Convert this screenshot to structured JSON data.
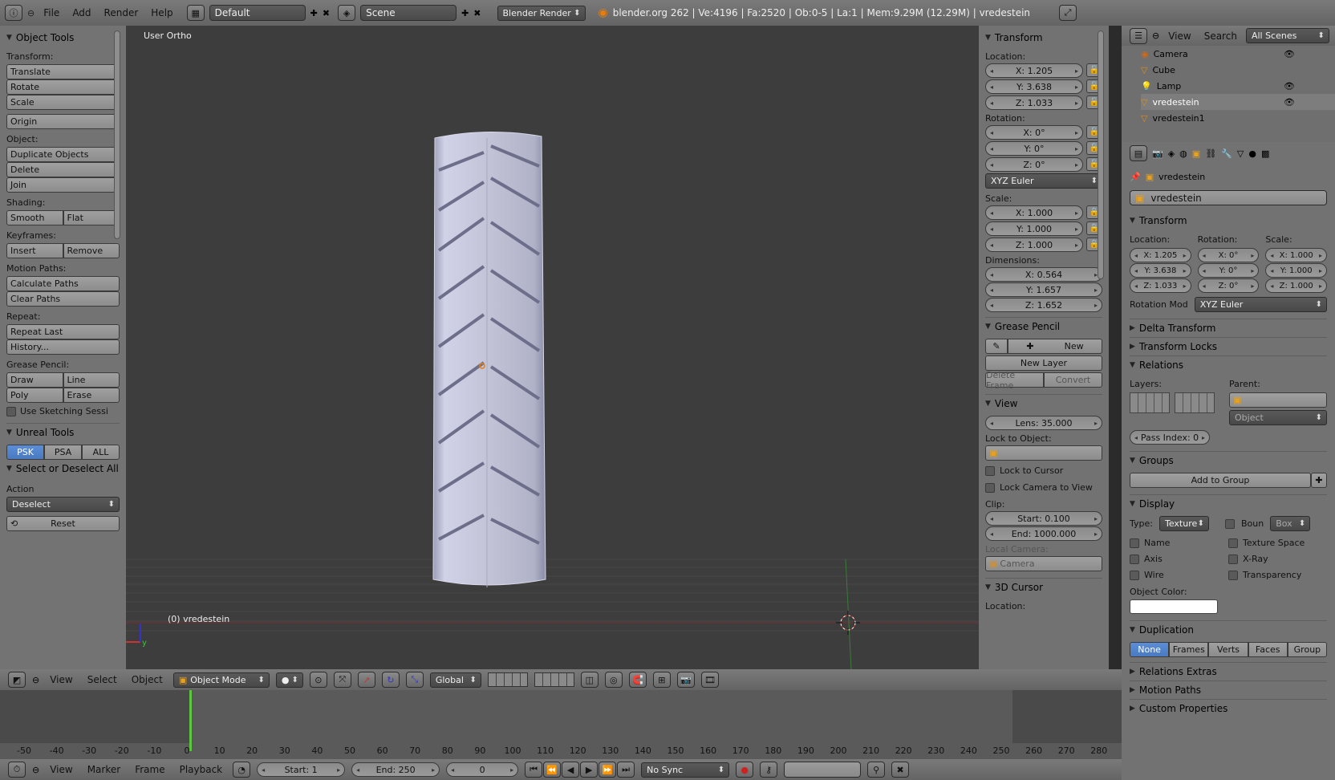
{
  "topbar": {
    "menus": [
      "File",
      "Add",
      "Render",
      "Help"
    ],
    "layout": "Default",
    "scene": "Scene",
    "engine": "Blender Render",
    "stats": "blender.org 262 | Ve:4196 | Fa:2520 | Ob:0-5 | La:1 | Mem:9.29M (12.29M) | vredestein"
  },
  "toolshelf": {
    "title": "Object Tools",
    "transform_label": "Transform:",
    "translate": "Translate",
    "rotate": "Rotate",
    "scale": "Scale",
    "origin": "Origin",
    "object_label": "Object:",
    "duplicate": "Duplicate Objects",
    "delete": "Delete",
    "join": "Join",
    "shading_label": "Shading:",
    "smooth": "Smooth",
    "flat": "Flat",
    "keyframes_label": "Keyframes:",
    "insert": "Insert",
    "remove": "Remove",
    "motion_label": "Motion Paths:",
    "calc_paths": "Calculate Paths",
    "clear_paths": "Clear Paths",
    "repeat_label": "Repeat:",
    "repeat_last": "Repeat Last",
    "history": "History...",
    "grease_label": "Grease Pencil:",
    "draw": "Draw",
    "line": "Line",
    "poly": "Poly",
    "erase": "Erase",
    "sketch": "Use Sketching Sessi",
    "unreal_title": "Unreal Tools",
    "psk": "PSK",
    "psa": "PSA",
    "all": "ALL",
    "select_title": "Select or Deselect All",
    "action_label": "Action",
    "action_value": "Deselect",
    "reset": "Reset"
  },
  "viewport": {
    "view_name": "User Ortho",
    "object_name": "(0) vredestein"
  },
  "npanel": {
    "transform_title": "Transform",
    "location_label": "Location:",
    "loc": [
      "X: 1.205",
      "Y: 3.638",
      "Z: 1.033"
    ],
    "rotation_label": "Rotation:",
    "rot": [
      "X: 0°",
      "Y: 0°",
      "Z: 0°"
    ],
    "rot_mode": "XYZ Euler",
    "scale_label": "Scale:",
    "scale": [
      "X: 1.000",
      "Y: 1.000",
      "Z: 1.000"
    ],
    "dim_label": "Dimensions:",
    "dim": [
      "X: 0.564",
      "Y: 1.657",
      "Z: 1.652"
    ],
    "grease_title": "Grease Pencil",
    "new": "New",
    "new_layer": "New Layer",
    "delete_frame": "Delete Frame",
    "convert": "Convert",
    "view_title": "View",
    "lens": "Lens: 35.000",
    "lock_obj_label": "Lock to Object:",
    "lock_cursor": "Lock to Cursor",
    "lock_camera": "Lock Camera to View",
    "clip_label": "Clip:",
    "clip_start": "Start: 0.100",
    "clip_end": "End: 1000.000",
    "local_camera_label": "Local Camera:",
    "local_camera": "Camera",
    "cursor_title": "3D Cursor",
    "cursor_location": "Location:"
  },
  "outliner": {
    "view": "View",
    "search": "Search",
    "scenes": "All Scenes",
    "items": [
      "Camera",
      "Cube",
      "Lamp",
      "vredestein",
      "vredestein1"
    ]
  },
  "properties": {
    "crumb": "vredestein",
    "name": "vredestein",
    "transform_title": "Transform",
    "loc_label": "Location:",
    "rot_label": "Rotation:",
    "scale_label": "Scale:",
    "loc": [
      "X: 1.205",
      "Y: 3.638",
      "Z: 1.033"
    ],
    "rot": [
      "X: 0°",
      "Y: 0°",
      "Z: 0°"
    ],
    "scale": [
      "X: 1.000",
      "Y: 1.000",
      "Z: 1.000"
    ],
    "rot_mode_label": "Rotation Mod",
    "rot_mode": "XYZ Euler",
    "delta": "Delta Transform",
    "locks": "Transform Locks",
    "relations": "Relations",
    "layers_label": "Layers:",
    "parent_label": "Parent:",
    "parent_type": "Object",
    "pass_index": "Pass Index: 0",
    "groups": "Groups",
    "add_group": "Add to Group",
    "display": "Display",
    "type_label": "Type:",
    "type_value": "Texture",
    "bounds": "Boun",
    "bounds_type": "Box",
    "name_chk": "Name",
    "texture_space": "Texture Space",
    "axis": "Axis",
    "xray": "X-Ray",
    "wire": "Wire",
    "transparency": "Transparency",
    "obj_color": "Object Color:",
    "duplication": "Duplication",
    "dup_tabs": [
      "None",
      "Frames",
      "Verts",
      "Faces",
      "Group"
    ],
    "rel_extras": "Relations Extras",
    "motion_paths": "Motion Paths",
    "custom_props": "Custom Properties"
  },
  "view3d_header": {
    "view": "View",
    "select": "Select",
    "object": "Object",
    "mode": "Object Mode",
    "orientation": "Global"
  },
  "timeline": {
    "ticks": [
      "-50",
      "-40",
      "-30",
      "-20",
      "-10",
      "0",
      "10",
      "20",
      "30",
      "40",
      "50",
      "60",
      "70",
      "80",
      "90",
      "100",
      "110",
      "120",
      "130",
      "140",
      "150",
      "160",
      "170",
      "180",
      "190",
      "200",
      "210",
      "220",
      "230",
      "240",
      "250",
      "260",
      "270",
      "280"
    ],
    "view": "View",
    "marker": "Marker",
    "frame": "Frame",
    "playback": "Playback",
    "start": "Start: 1",
    "end": "End: 250",
    "current": "0",
    "sync": "No Sync"
  }
}
